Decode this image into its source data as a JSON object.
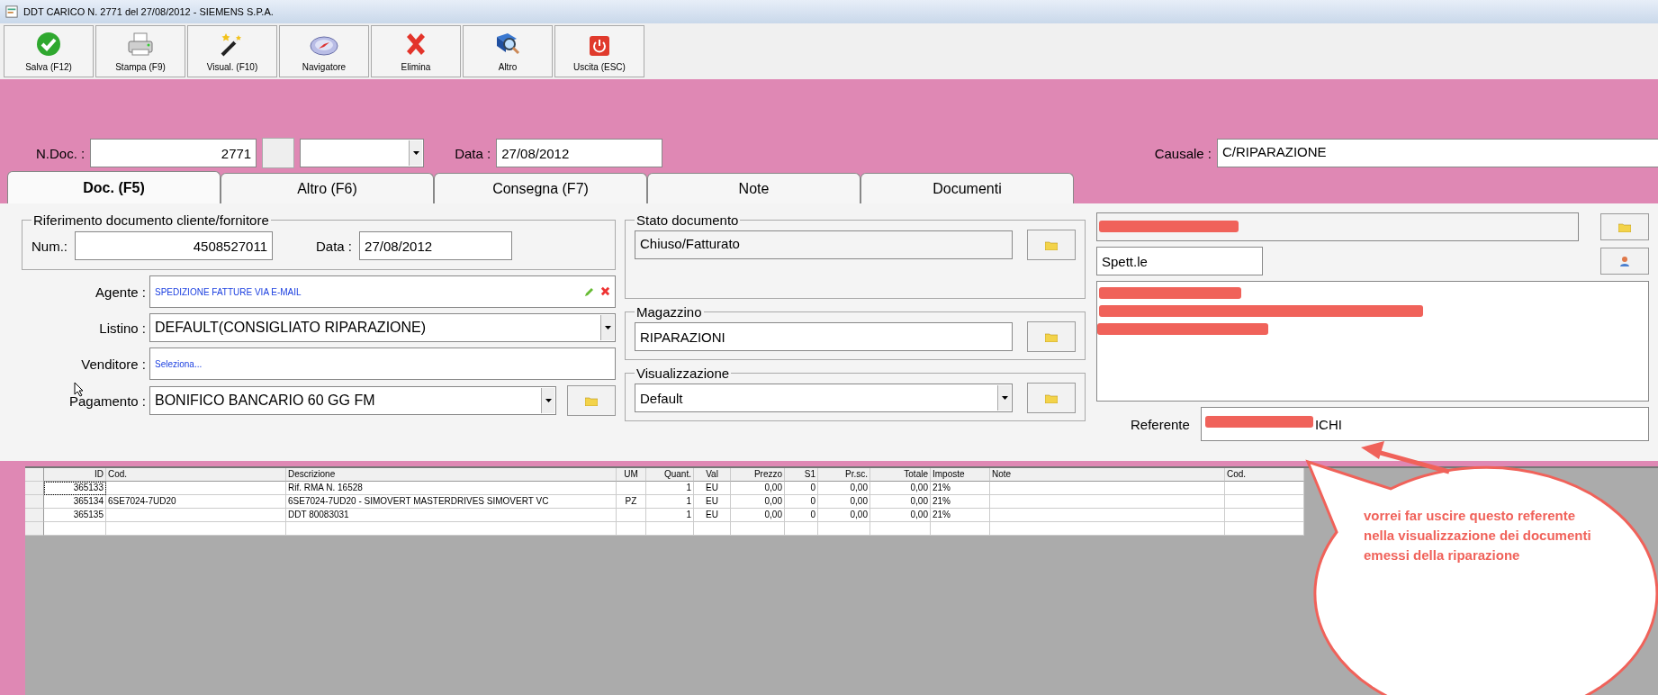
{
  "window": {
    "title": "DDT CARICO N. 2771  del 27/08/2012 - SIEMENS S.P.A."
  },
  "toolbar": [
    {
      "label": "Salva (F12)",
      "kind": "save"
    },
    {
      "label": "Stampa (F9)",
      "kind": "print"
    },
    {
      "label": "Visual. (F10)",
      "kind": "wand"
    },
    {
      "label": "Navigatore",
      "kind": "compass"
    },
    {
      "label": "Elimina",
      "kind": "delete"
    },
    {
      "label": "Altro",
      "kind": "book"
    },
    {
      "label": "Uscita (ESC)",
      "kind": "exit"
    }
  ],
  "header": {
    "ndoc_label": "N.Doc. :",
    "ndoc": "2771",
    "date_label": "Data :",
    "date": "27/08/2012",
    "causale_label": "Causale :",
    "causale": "C/RIPARAZIONE"
  },
  "tabs": [
    {
      "label": "Doc. (F5)",
      "selected": true
    },
    {
      "label": "Altro (F6)",
      "selected": false
    },
    {
      "label": "Consegna (F7)",
      "selected": false
    },
    {
      "label": "Note",
      "selected": false
    },
    {
      "label": "Documenti",
      "selected": false
    }
  ],
  "riferimento": {
    "title": "Riferimento documento cliente/fornitore",
    "num_label": "Num.:",
    "num": "4508527011",
    "date_label": "Data :",
    "date": "27/08/2012"
  },
  "fields": [
    {
      "kind": "link",
      "label": "Agente :",
      "value": "SPEDIZIONE FATTURE VIA E-MAIL"
    },
    {
      "kind": "combo",
      "label": "Listino :",
      "value": "DEFAULT(CONSIGLIATO RIPARAZIONE)"
    },
    {
      "kind": "link",
      "label": "Venditore :",
      "value": "Seleziona..."
    },
    {
      "kind": "combo-folder",
      "label": "Pagamento :",
      "value": "BONIFICO BANCARIO 60 GG FM"
    }
  ],
  "stato": {
    "title": "Stato documento",
    "value": "Chiuso/Fatturato"
  },
  "magazzino": {
    "title": "Magazzino",
    "value": "RIPARAZIONI"
  },
  "visualizzazione": {
    "title": "Visualizzazione",
    "value": "Default"
  },
  "cliente": {
    "salutation": "Spett.le",
    "referente_label": "Referente",
    "referente": "ICHI"
  },
  "grid": {
    "columns": [
      "ID",
      "Cod.",
      "Descrizione",
      "UM",
      "Quant.",
      "Val",
      "Prezzo",
      "S1",
      "Pr.sc.",
      "Totale",
      "Imposte",
      "Note",
      "Cod."
    ],
    "rows": [
      [
        "365133",
        "",
        "Rif. RMA N. 16528",
        "",
        "1",
        "EU",
        "0,00",
        "0",
        "0,00",
        "0,00",
        "21%",
        "",
        ""
      ],
      [
        "365134",
        "6SE7024-7UD20",
        "6SE7024-7UD20 - SIMOVERT MASTERDRIVES SIMOVERT VC",
        "PZ",
        "1",
        "EU",
        "0,00",
        "0",
        "0,00",
        "0,00",
        "21%",
        "",
        ""
      ],
      [
        "365135",
        "",
        "DDT 80083031",
        "",
        "1",
        "EU",
        "0,00",
        "0",
        "0,00",
        "0,00",
        "21%",
        "",
        ""
      ]
    ]
  },
  "annotation": {
    "text": "vorrei far uscire questo referente nella visualizzazione dei documenti emessi della riparazione"
  }
}
